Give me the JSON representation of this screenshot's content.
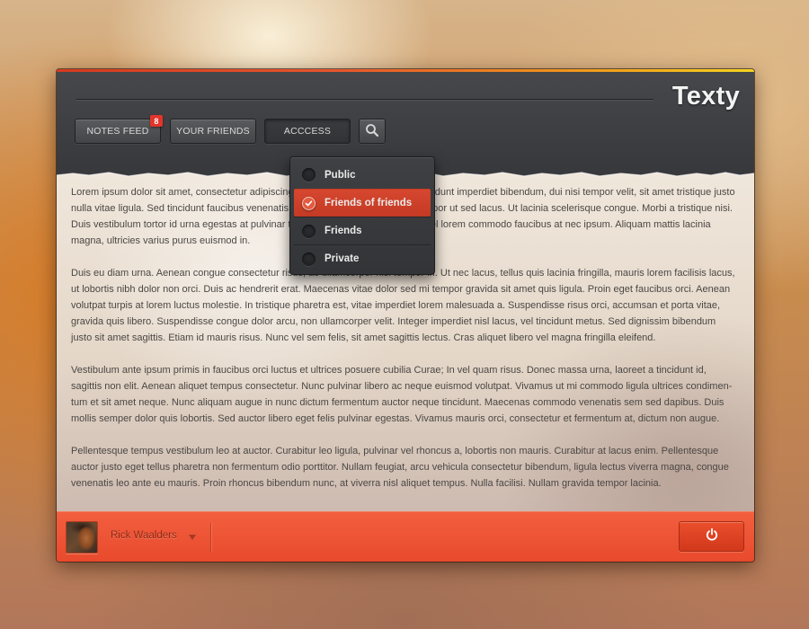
{
  "app": {
    "title": "Texty"
  },
  "nav": {
    "notes_feed": "NOTES FEED",
    "notes_feed_badge": "8",
    "your_friends": "YOUR FRIENDS",
    "access": "ACCCESS"
  },
  "search": {
    "icon": "search-icon"
  },
  "access_menu": {
    "items": [
      {
        "label": "Public",
        "selected": false
      },
      {
        "label": "Friends of friends",
        "selected": true
      },
      {
        "label": "Friends",
        "selected": false
      },
      {
        "label": "Private",
        "selected": false
      }
    ]
  },
  "content": {
    "paragraphs": [
      "Lorem ipsum dolor sit amet, consectetur adipiscing elit. Sed at nunc sed ligula, tincidunt imperdiet bibendum, dui nisi tempor velit, sit amet tristique justo nulla vitae ligula. Sed tincidunt faucibus venenatis. Vivamus suscipit, purus vel tempor ut sed lacus. Ut lacinia scelerisque congue. Morbi a tristique nisi. Duis vestibulum tortor id urna egestas at pulvinar tellus rutrum. Nulla lectus nulla vel lorem commodo faucibus at nec ipsum. Aliquam mattis lacinia magna, ultricies varius purus euismod in.",
      "Duis eu diam urna. Aenean congue consectetur risus, ac ullamcorper nisi tempor in. Ut nec lacus, tellus quis lacinia fringilla, mauris lorem facilisis lacus, ut lobortis nibh dolor non orci. Duis ac hendrerit erat. Maecenas vitae dolor sed mi tempor gravida sit amet quis ligula. Proin eget faucibus orci. Aenean volutpat turpis at lorem luctus molestie. In tristique pharetra est, vitae imperdiet lorem malesuada a. Suspendisse risus orci, accumsan et porta vitae, gravida quis libero. Suspendisse congue dolor arcu, non ullamcorper velit. Integer imperdiet nisl lacus, vel tincidunt metus. Sed dignissim bibendum justo sit amet sagittis. Etiam id mauris risus. Nunc vel sem felis, sit amet sagittis lectus. Cras aliquet libero vel magna fringilla eleifend.",
      "Vestibulum ante ipsum primis in faucibus orci luctus et ultrices posuere cubilia Curae; In vel quam risus. Donec massa urna, laoreet a tincidunt id, sagittis non elit. Aenean aliquet tempus consectetur. Nunc pulvinar libero ac neque euismod volutpat. Vivamus ut mi commodo ligula ultrices condimen-tum et sit amet neque. Nunc aliquam augue in nunc dictum fermentum auctor neque tincidunt. Maecenas commodo venenatis sem sed dapibus. Duis mollis semper dolor quis lobortis. Sed auctor libero eget felis pulvinar egestas. Vivamus mauris orci, consectetur et fermentum at, dictum non augue.",
      "Pellentesque tempus vestibulum leo at auctor. Curabitur leo ligula, pulvinar vel rhoncus a, lobortis non mauris. Curabitur at lacus enim. Pellentesque auctor justo eget tellus pharetra non fermentum odio porttitor. Nullam feugiat, arcu vehicula consectetur bibendum, ligula lectus viverra magna, congue venenatis leo ante eu mauris. Proin rhoncus bibendum nunc, at viverra nisl aliquet tempus. Nulla facilisi. Nullam gravida tempor lacinia."
    ]
  },
  "footer": {
    "user_name": "Rick Waalders",
    "power_icon": "power-icon"
  },
  "colors": {
    "accent": "#e84a2c",
    "header": "#3d3e41",
    "selected_item": "#d6472f"
  }
}
